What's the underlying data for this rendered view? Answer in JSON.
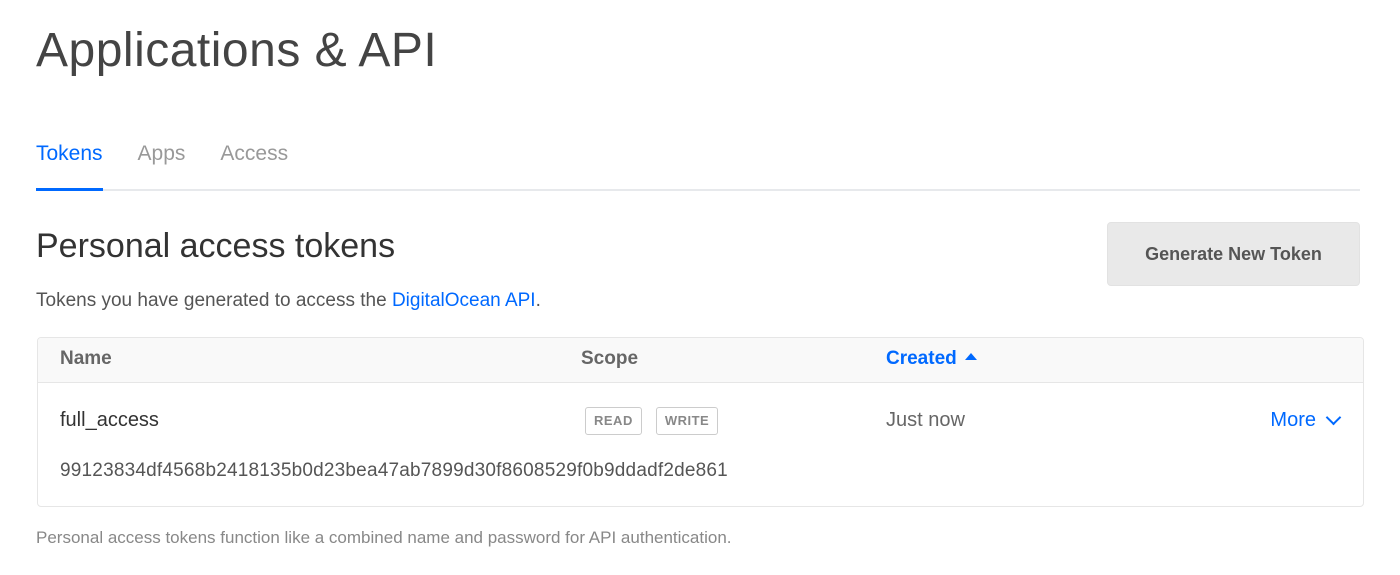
{
  "page": {
    "title": "Applications & API"
  },
  "tabs": [
    {
      "label": "Tokens",
      "active": true
    },
    {
      "label": "Apps",
      "active": false
    },
    {
      "label": "Access",
      "active": false
    }
  ],
  "section": {
    "title": "Personal access tokens",
    "description_prefix": "Tokens you have generated to access the ",
    "description_link": "DigitalOcean API",
    "description_suffix": ".",
    "generate_button": "Generate New Token",
    "footnote": "Personal access tokens function like a combined name and password for API authentication."
  },
  "table": {
    "columns": {
      "name": "Name",
      "scope": "Scope",
      "created": "Created"
    },
    "sort": {
      "column": "created",
      "direction": "ascending"
    },
    "rows": [
      {
        "name": "full_access",
        "scopes": [
          "READ",
          "WRITE"
        ],
        "created": "Just now",
        "more_label": "More",
        "token": "99123834df4568b2418135b0d23bea47ab7899d30f8608529f0b9ddadf2de861"
      }
    ]
  },
  "colors": {
    "accent": "#0069ff",
    "button_bg": "#e9e9e9",
    "border": "#e6e6e6",
    "muted_text": "#999999"
  },
  "icons": {
    "sort": "caret-up-icon",
    "more": "chevron-down-icon"
  }
}
